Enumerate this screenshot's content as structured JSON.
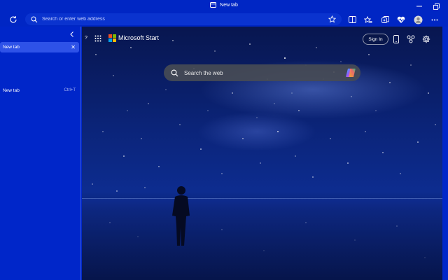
{
  "window": {
    "title": "New tab"
  },
  "toolbar": {
    "address_placeholder": "Search or enter web address"
  },
  "sidebar": {
    "active_tab_label": "New tab",
    "new_tab_label": "New tab",
    "new_tab_shortcut": "Ctrl+T"
  },
  "page": {
    "help_label": "?",
    "brand": "Microsoft Start",
    "sign_in": "Sign In",
    "search_placeholder": "Search the web"
  }
}
